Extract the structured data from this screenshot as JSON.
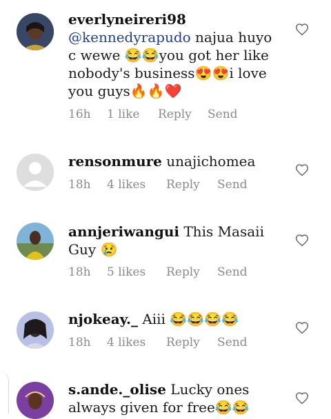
{
  "comments": [
    {
      "username": "everlyneireri98",
      "mention": "@kennedyrapudo",
      "text": " najua huyo c wewe 😂😂you got her like nobody's business😍😍i love you guys🔥🔥❤️",
      "time": "16h",
      "likes": "1 like",
      "reply": "Reply",
      "send": "Send",
      "avatar": "photo-avatar"
    },
    {
      "username": "rensonmure",
      "text": "unajichomea",
      "time": "18h",
      "likes": "4 likes",
      "reply": "Reply",
      "send": "Send",
      "avatar": "default-avatar"
    },
    {
      "username": "annjeriwangui",
      "text": "This Masaii Guy 😢",
      "time": "18h",
      "likes": "5 likes",
      "reply": "Reply",
      "send": "Send",
      "avatar": "photo-avatar"
    },
    {
      "username": "njokeay._",
      "text": "Aiii 😂😂😂😂",
      "time": "18h",
      "likes": "4 likes",
      "reply": "Reply",
      "send": "Send",
      "avatar": "photo-avatar"
    },
    {
      "username": "s.ande._olise",
      "text": "Lucky ones always given for free😂😂",
      "avatar": "photo-avatar"
    }
  ],
  "icons": {
    "like": "heart-outline-icon"
  },
  "colors": {
    "mention": "#1f3f8f",
    "meta": "#8a8a8a"
  }
}
